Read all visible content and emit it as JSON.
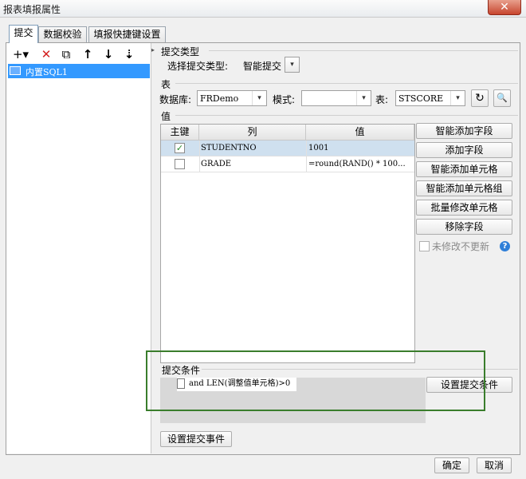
{
  "window": {
    "title": "报表填报属性",
    "close_glyph": "✕"
  },
  "tabs": [
    {
      "label": "提交",
      "active": true
    },
    {
      "label": "数据校验",
      "active": false
    },
    {
      "label": "填报快捷键设置",
      "active": false
    }
  ],
  "toolbar": [
    {
      "icon": "add-icon",
      "glyph": "+▾"
    },
    {
      "icon": "delete-icon",
      "glyph": "✕"
    },
    {
      "icon": "copy-icon",
      "glyph": "⧉"
    },
    {
      "icon": "move-up-icon",
      "glyph": "↑"
    },
    {
      "icon": "move-down-icon",
      "glyph": "↓"
    },
    {
      "icon": "sort-icon",
      "glyph": "⇣"
    }
  ],
  "tree": {
    "items": [
      {
        "label": "内置SQL1",
        "icon": "database-icon"
      }
    ]
  },
  "submit_type": {
    "section_label": "提交类型",
    "select_label": "选择提交类型:",
    "value": "智能提交"
  },
  "table_section": {
    "section_label": "表",
    "db_label": "数据库:",
    "db_value": "FRDemo",
    "mode_label": "模式:",
    "mode_value": "",
    "table_label": "表:",
    "table_value": "STSCORE"
  },
  "values_section": {
    "section_label": "值",
    "columns": [
      "主键",
      "列",
      "值"
    ],
    "rows": [
      {
        "key": true,
        "column": "STUDENTNO",
        "value": "1001"
      },
      {
        "key": false,
        "column": "GRADE",
        "value": "=round(RAND() * 100..."
      }
    ],
    "buttons": [
      "智能添加字段",
      "添加字段",
      "智能添加单元格",
      "智能添加单元格组",
      "批量修改单元格",
      "移除字段"
    ],
    "no_update_label": "未修改不更新"
  },
  "condition": {
    "section_label": "提交条件",
    "expression": "and LEN(调整值单元格)>0",
    "button": "设置提交条件"
  },
  "event_button": "设置提交事件",
  "footer": {
    "ok": "确定",
    "cancel": "取消"
  },
  "colors": {
    "selection": "#3399ff",
    "highlight_box": "#3a7d2c",
    "close": "#c7452e"
  }
}
